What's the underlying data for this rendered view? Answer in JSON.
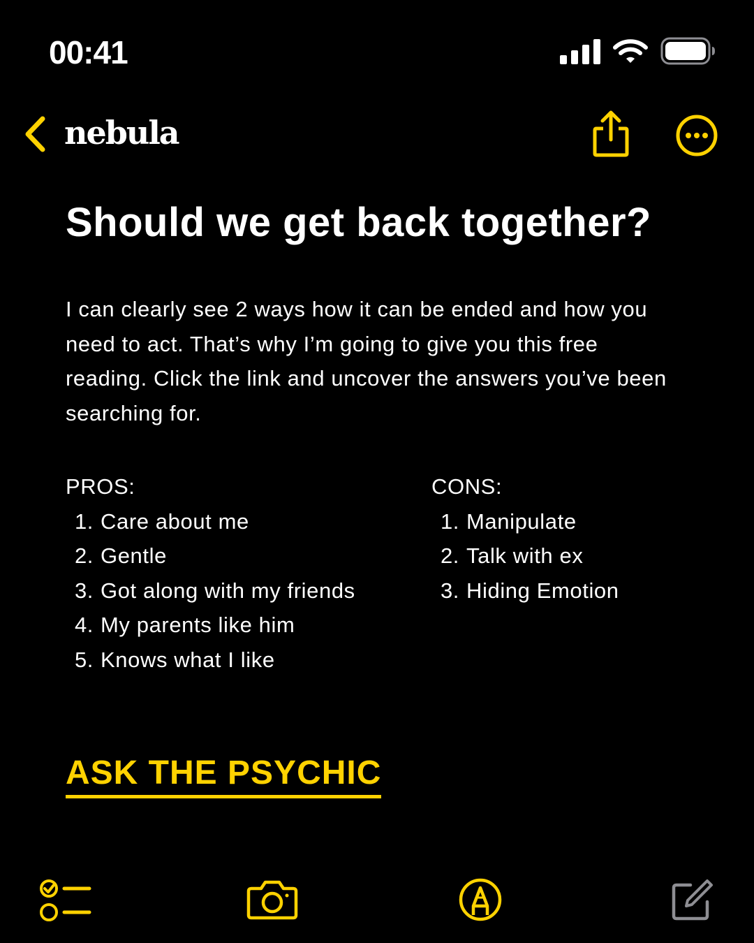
{
  "status_bar": {
    "time": "00:41"
  },
  "nav": {
    "title": "nebula"
  },
  "note": {
    "title": "Should we get back together?",
    "body": "I can clearly see 2 ways how it can be ended and how you need to act. That’s why I’m going to give you this free reading. Click the link and uncover the answers you’ve been searching for."
  },
  "pros": {
    "heading": "PROS:",
    "items": [
      {
        "num": "1.",
        "text": "Care about me"
      },
      {
        "num": "2.",
        "text": "Gentle"
      },
      {
        "num": "3.",
        "text": "Got along with my friends"
      },
      {
        "num": "4.",
        "text": "My parents like him"
      },
      {
        "num": "5.",
        "text": "Knows what I like"
      }
    ]
  },
  "cons": {
    "heading": "CONS:",
    "items": [
      {
        "num": "1.",
        "text": "Manipulate"
      },
      {
        "num": "2.",
        "text": "Talk with ex"
      },
      {
        "num": "3.",
        "text": "Hiding Emotion"
      }
    ]
  },
  "cta": {
    "label": "ASK THE PSYCHIC"
  },
  "icons": {
    "back": "chevron-left-icon",
    "share": "share-icon",
    "more": "ellipsis-circle-icon",
    "checklist": "checklist-icon",
    "camera": "camera-icon",
    "markup": "pen-tip-circle-icon",
    "compose": "compose-icon",
    "signal": "cellular-signal-icon",
    "wifi": "wifi-icon",
    "battery": "battery-icon"
  },
  "colors": {
    "accent": "#FFD200",
    "background": "#000000",
    "text": "#FFFFFF",
    "disabled": "#8E8E93"
  }
}
